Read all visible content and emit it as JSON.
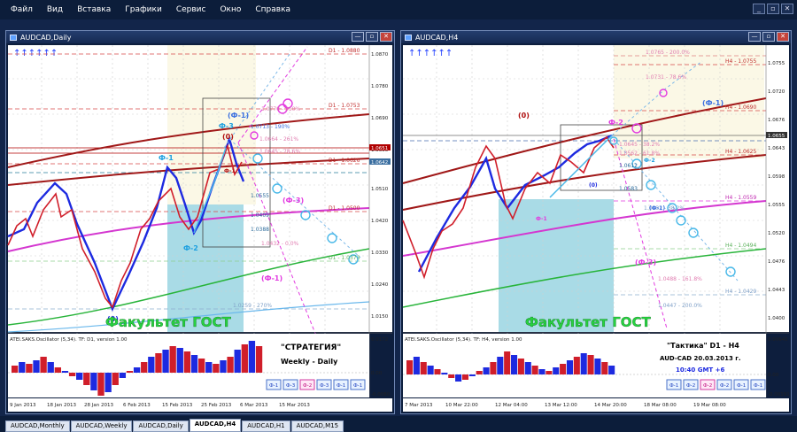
{
  "menu": [
    "Файл",
    "Вид",
    "Вставка",
    "Графики",
    "Сервис",
    "Окно",
    "Справка"
  ],
  "mdi_controls": [
    "_",
    "▫",
    "✕"
  ],
  "window_controls": [
    "—",
    "▫",
    "✕"
  ],
  "left": {
    "title": "AUDCAD,Daily",
    "watermark": "Факультет ГОСТ",
    "osc_label": "ATEI.SAKS.Oscillator (5,34). TF: D1, version 1.00",
    "info_title": "\"СТРАТЕГИЯ\"",
    "info_sub": "Weekly - Daily",
    "buttons": [
      "Ф-1",
      "Ф-3",
      "Ф-2",
      "Ф-3",
      "Ф-1",
      "Ф-1"
    ],
    "price_labels": [
      "1.0870",
      "1.0780",
      "1.0690",
      "1.0600",
      "1.0510",
      "1.0420",
      "1.0330",
      "1.0240",
      "1.0150"
    ],
    "osc_scale": [
      "0.0172",
      "0.00",
      "-0.0080"
    ],
    "date_labels": [
      "9 Jan 2013",
      "18 Jan 2013",
      "28 Jan 2013",
      "6 Feb 2013",
      "15 Feb 2013",
      "25 Feb 2013",
      "6 Mar 2013",
      "15 Mar 2013"
    ],
    "levels": [
      "D1 - 1.0880",
      "D1 - 1.0753",
      "D1 - 1.0626",
      "D1 - 1.0500",
      "D1 - 1.0373",
      "1.0259 - 270%"
    ],
    "fib": [
      "1.0770 - 310%",
      "1.0713 - 190%",
      "1.0664 - 261%",
      "1.0645 - 78.6%",
      "1.0555",
      "1.0409",
      "1.0388",
      "1.0432 - 0.0%"
    ],
    "current_prices": [
      "1.0651",
      "1.0642"
    ],
    "wave_labels": [
      "Ф-1",
      "Ф-2",
      "Ф-3",
      "(Ф-1)",
      "(Ф-3)",
      "(Ф-1)",
      "(0)",
      "(0)",
      "Ф-1"
    ]
  },
  "right": {
    "title": "AUDCAD,H4",
    "watermark": "Факультет ГОСТ",
    "osc_label": "ATEI.SAKS.Oscillator (5,34). TF: H4, version 1.00",
    "info_title": "\"Тактика\"  D1 - H4",
    "info_date": "AUD-CAD     20.03.2013  г.",
    "info_time": "10:40  GMT +6",
    "buttons": [
      "Ф-1",
      "Ф-2",
      "Ф-2",
      "Ф-2",
      "Ф-1",
      "Ф-1"
    ],
    "price_labels": [
      "1.0755",
      "1.0720",
      "1.0676",
      "1.0643",
      "1.0598",
      "1.0555",
      "1.0520",
      "1.0476",
      "1.0443",
      "1.0400"
    ],
    "osc_scale": [
      "0.00645",
      "0.00",
      "-0.00191"
    ],
    "date_labels": [
      "7 Mar 2013",
      "10 Mar 22:00",
      "12 Mar 04:00",
      "13 Mar 12:00",
      "14 Mar 20:00",
      "18 Mar 08:00",
      "19 Mar 08:00"
    ],
    "levels": [
      "H4 - 1.0755",
      "H4 - 1.0690",
      "H4 - 1.0625",
      "H4 - 1.0559",
      "H4 - 1.0494",
      "H4 - 1.0429"
    ],
    "fib": [
      "1.0765 - 200.0%",
      "1.0731 - 78.6%",
      "1.0645 - 38.2%",
      "1.0612",
      "1.0583",
      "1.0562 - 61.8%",
      "1.0532 - 38.2%",
      "1.0488 - 161.8%",
      "1.0447 - 200.0%"
    ],
    "current_prices": [
      "1.0655"
    ],
    "wave_labels": [
      "(0)",
      "Ф-2",
      "(Ф-1)",
      "(Ф-3)",
      "Ф-1",
      "(0)",
      "Ф-2",
      "(Ф-1)"
    ]
  },
  "tabs": [
    "AUDCAD,Monthly",
    "AUDCAD,Weekly",
    "AUDCAD,Daily",
    "AUDCAD,H4",
    "AUDCAD,H1",
    "AUDCAD,M15"
  ],
  "active_tab": "AUDCAD,H4",
  "colors": {
    "accent_cyan": "#5bc8e8",
    "magenta": "#e23ae0",
    "blue_wave": "#1d2ae0",
    "red_wave": "#d01e2a",
    "dark_red": "#8b1a1a",
    "green_ma": "#27b23a"
  }
}
